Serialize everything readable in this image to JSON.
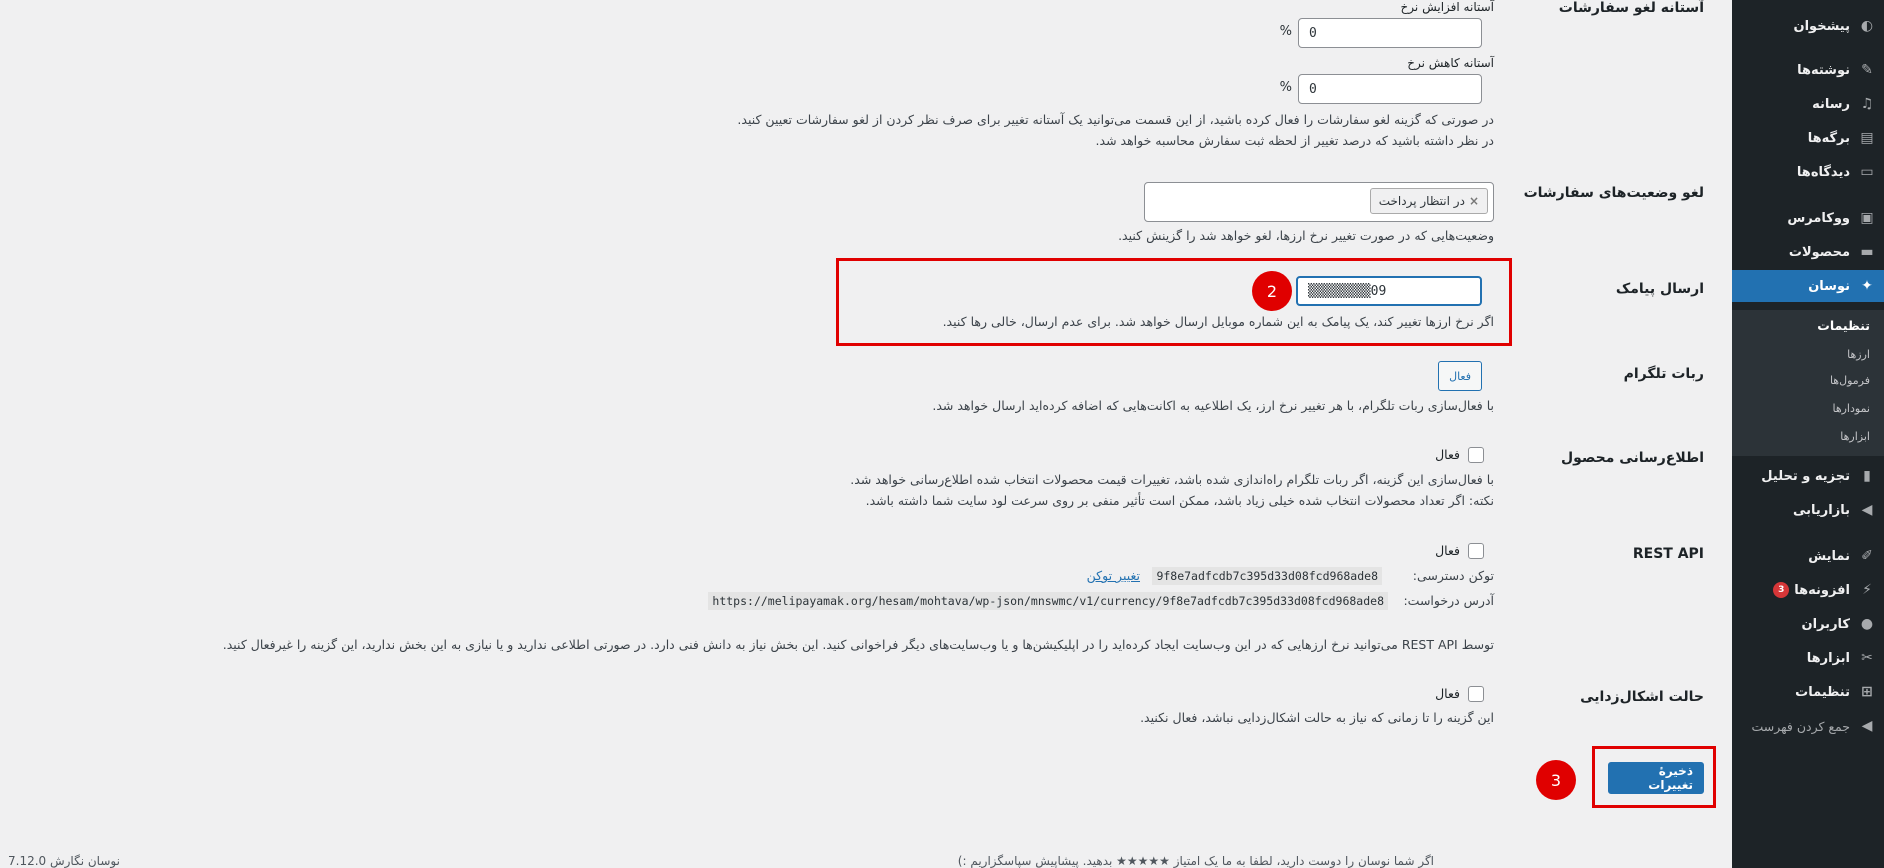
{
  "sidebar": {
    "items": [
      {
        "label": "پیشخوان",
        "icon": "dashboard-icon"
      },
      {
        "label": "نوشته‌ها",
        "icon": "pin-icon"
      },
      {
        "label": "رسانه",
        "icon": "media-icon"
      },
      {
        "label": "برگه‌ها",
        "icon": "page-icon"
      },
      {
        "label": "دیدگاه‌ها",
        "icon": "comment-icon"
      },
      {
        "label": "ووکامرس",
        "icon": "woo-icon"
      },
      {
        "label": "محصولات",
        "icon": "archive-icon"
      },
      {
        "label": "نوسان",
        "icon": "navasan-icon"
      },
      {
        "label": "تجزیه و تحلیل",
        "icon": "chart-icon"
      },
      {
        "label": "بازاریابی",
        "icon": "megaphone-icon"
      },
      {
        "label": "نمایش",
        "icon": "brush-icon"
      },
      {
        "label": "افزونه‌ها",
        "icon": "plugin-icon",
        "badge": "3"
      },
      {
        "label": "کاربران",
        "icon": "user-icon"
      },
      {
        "label": "ابزارها",
        "icon": "wrench-icon"
      },
      {
        "label": "تنظیمات",
        "icon": "settings-icon"
      }
    ],
    "submenu": [
      "تنظیمات",
      "ارزها",
      "فرمول‌ها",
      "نمودارها",
      "ابزارها"
    ],
    "collapse_label": "جمع کردن فهرست"
  },
  "settings": {
    "cancel_threshold": {
      "label": "آستانه لغو سفارشات",
      "increase_label": "آستانه افزایش نرخ",
      "increase_value": "0",
      "decrease_label": "آستانه کاهش نرخ",
      "decrease_value": "0",
      "percent": "%",
      "desc1": "در صورتی که گزینه لغو سفارشات را فعال کرده باشید، از این قسمت می‌توانید یک آستانه تغییر برای صرف نظر کردن از لغو سفارشات تعیین کنید.",
      "desc2": "در نظر داشته باشید که درصد تغییر از لحظه ثبت سفارش محاسبه خواهد شد."
    },
    "cancel_statuses": {
      "label": "لغو وضعیت‌های سفارشات",
      "tag": "در انتظار پرداخت",
      "tag_remove": "×",
      "desc": "وضعیت‌هایی که در صورت تغییر نرخ ارزها، لغو خواهد شد را گزینش کنید."
    },
    "sms": {
      "label": "ارسال پیامک",
      "value": "09▒▒▒▒▒▒▒▒",
      "desc": "اگر نرخ ارزها تغییر کند، یک پیامک به این شماره موبایل ارسال خواهد شد. برای عدم ارسال، خالی رها کنید.",
      "marker": "2"
    },
    "telegram": {
      "label": "ربات تلگرام",
      "button": "فعال",
      "desc": "با فعال‌سازی ربات تلگرام، با هر تغییر نرخ ارز، یک اطلاعیه به اکانت‌هایی که اضافه کرده‌اید ارسال خواهد شد."
    },
    "product_notify": {
      "label": "اطلاع‌رسانی محصول",
      "checkbox_label": "فعال",
      "desc1": "با فعال‌سازی این گزینه، اگر ربات تلگرام راه‌اندازی شده باشد، تغییرات قیمت محصولات انتخاب شده اطلاع‌رسانی خواهد شد.",
      "desc2": "نکته: اگر تعداد محصولات انتخاب شده خیلی زیاد باشد، ممکن است تأثیر منفی بر روی سرعت لود سایت شما داشته باشد."
    },
    "rest_api": {
      "label": "REST API",
      "checkbox_label": "فعال",
      "token_label": "توکن دسترسی:",
      "token": "9f8e7adfcdb7c395d33d08fcd968ade8",
      "change_token": "تغییر توکن",
      "url_label": "آدرس درخواست:",
      "url": "https://melipayamak.org/hesam/mohtava/wp-json/mnswmc/v1/currency/9f8e7adfcdb7c395d33d08fcd968ade8",
      "desc": "توسط REST API می‌توانید نرخ ارزهایی که در این وب‌سایت ایجاد کرده‌اید را در اپلیکیشن‌ها و یا وب‌سایت‌های دیگر فراخوانی کنید. این بخش نیاز به دانش فنی دارد. در صورتی اطلاعی ندارید و یا نیازی به این بخش ندارید، این گزینه را غیرفعال کنید."
    },
    "debug": {
      "label": "حالت اشکال‌زدایی",
      "checkbox_label": "فعال",
      "desc": "این گزینه را تا زمانی که نیاز به حالت اشکال‌زدایی نباشد، فعال نکنید."
    },
    "save_button": "ذخیرهٔ تغییرات",
    "save_marker": "3"
  },
  "footer": {
    "left": "نوسان نگارش 7.12.0",
    "right": "اگر شما نوسان را دوست دارید، لطفا به ما یک امتیاز ★★★★★ بدهید. پیشاپیش سپاسگزاریم :)"
  },
  "colors": {
    "accent": "#2271b1",
    "sidebar": "#1d2327",
    "highlight": "#e00000"
  }
}
